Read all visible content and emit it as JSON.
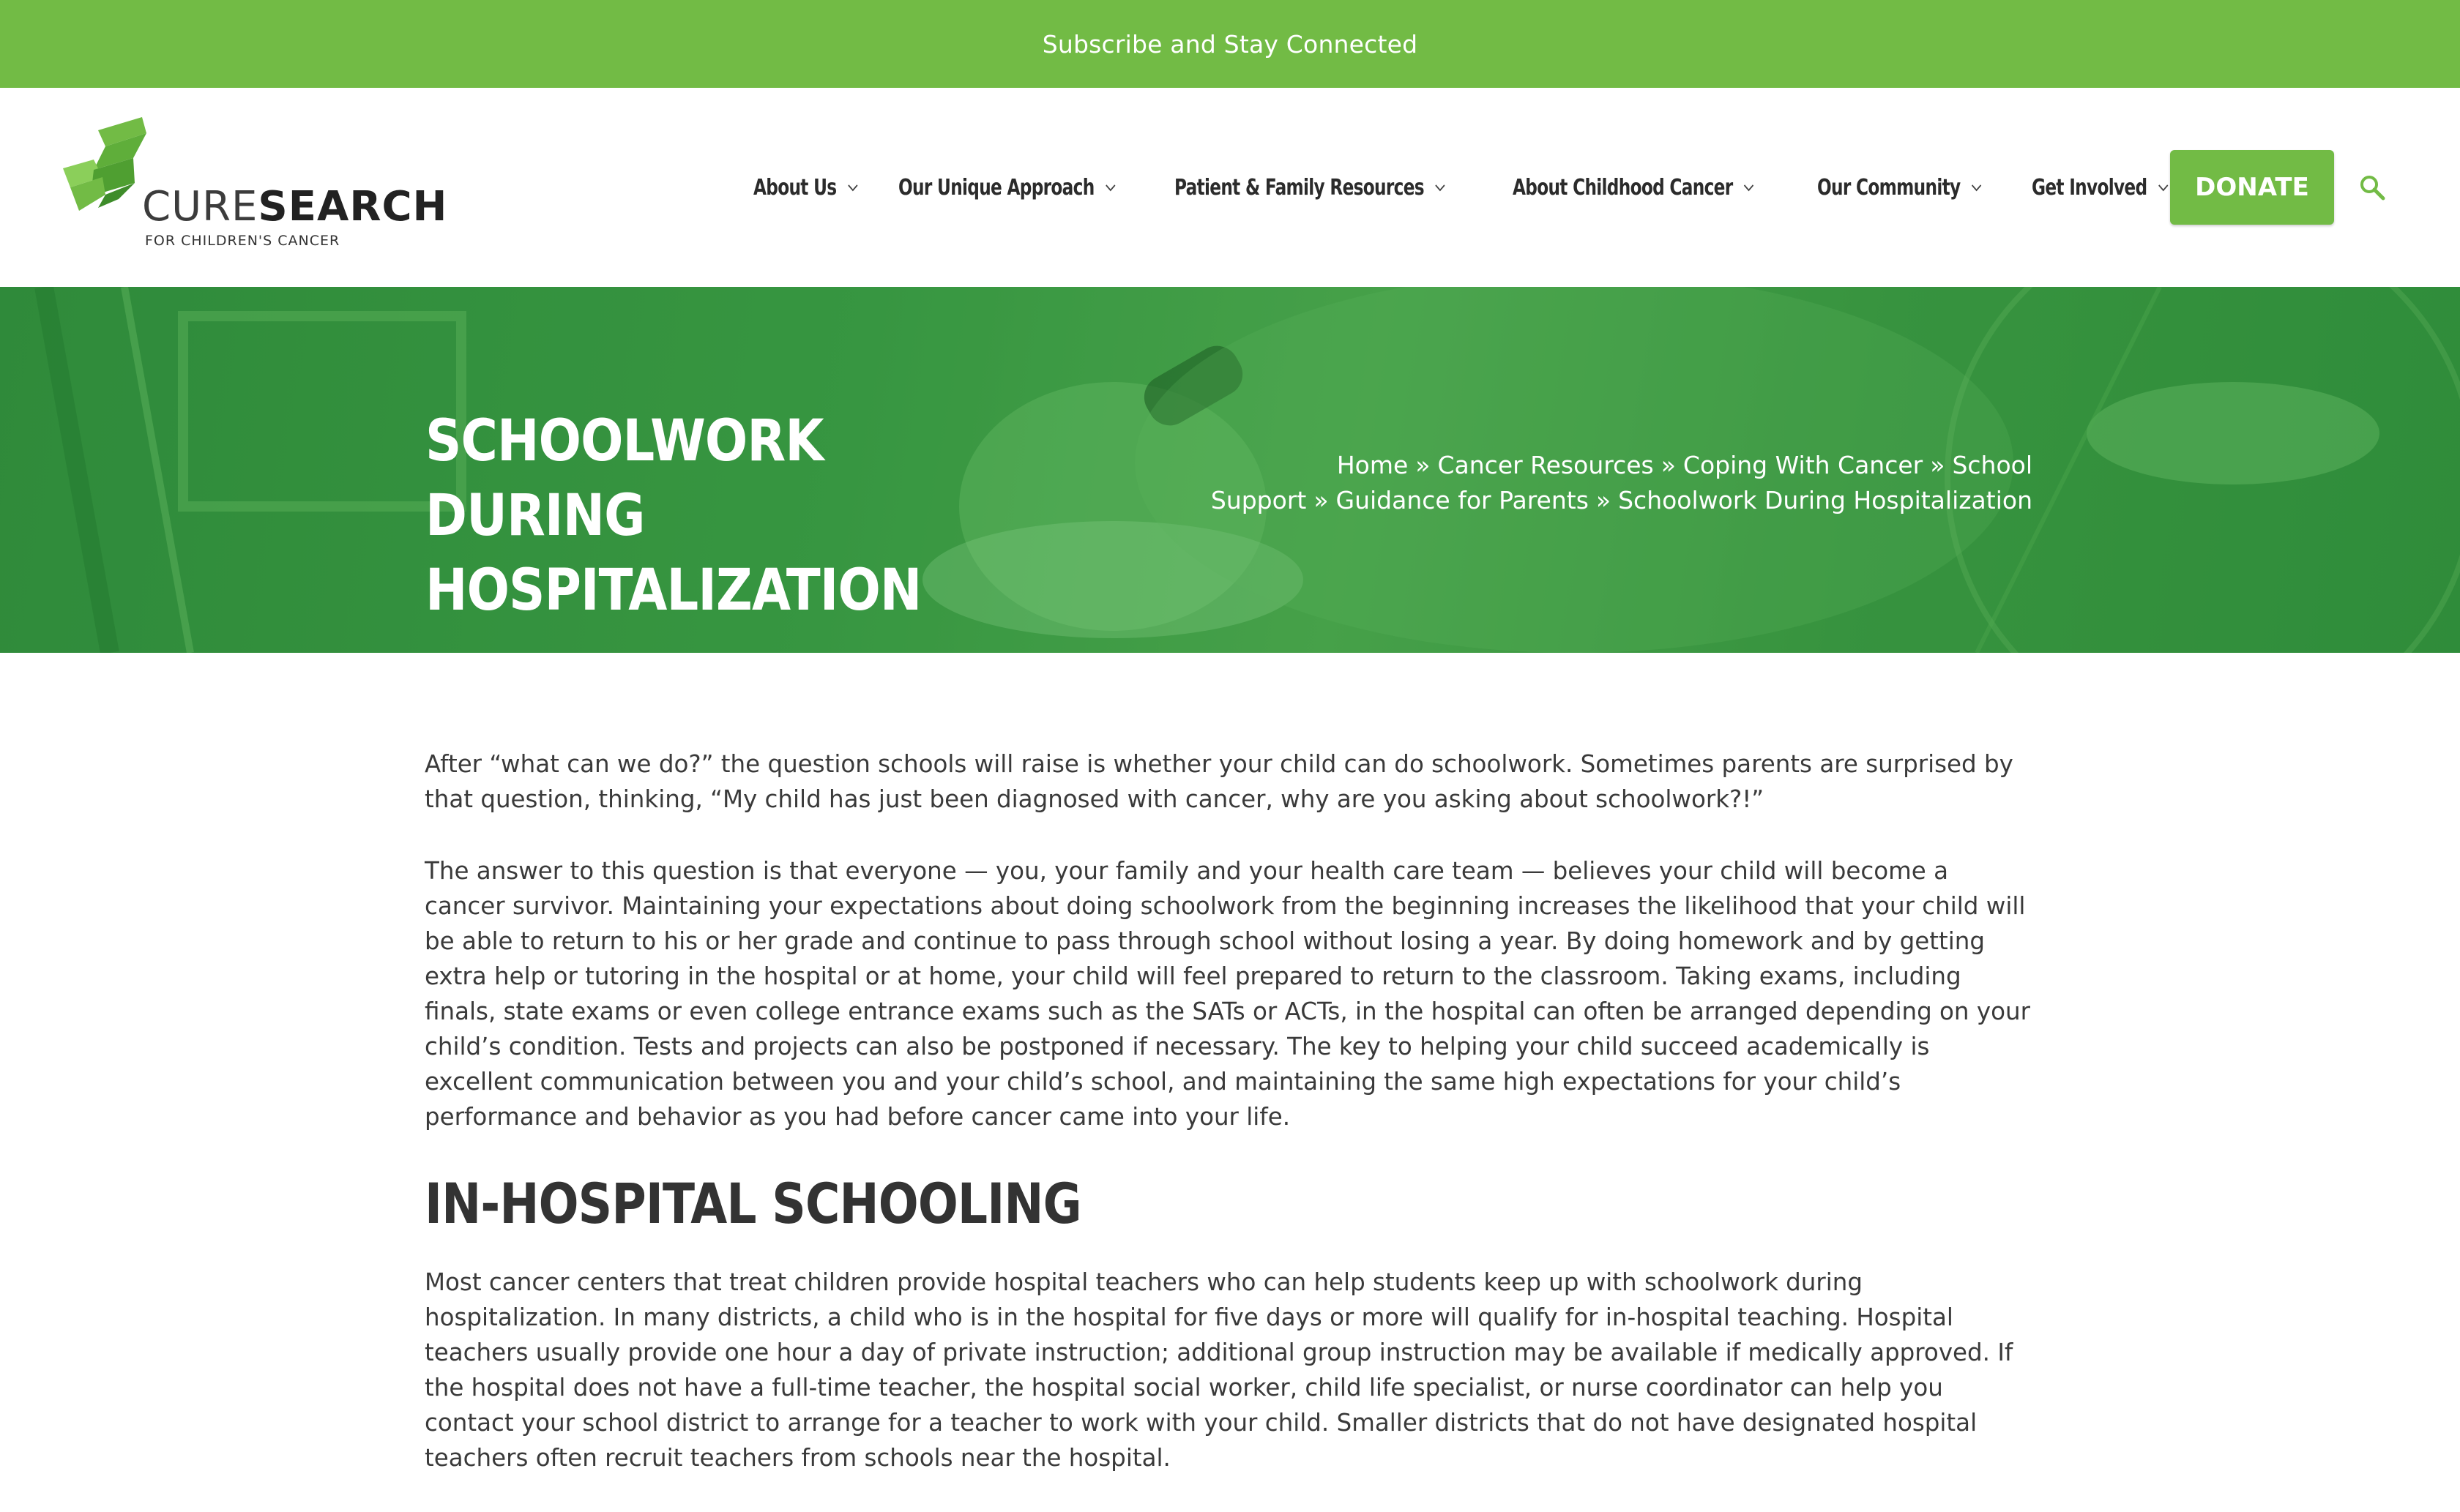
{
  "topbar": {
    "link": "Subscribe and Stay Connected"
  },
  "logo": {
    "cure": "CURE",
    "search": "SEARCH",
    "tagline": "FOR CHILDREN'S CANCER"
  },
  "nav": {
    "items": [
      {
        "label": "About Us"
      },
      {
        "label": "Our Unique Approach"
      },
      {
        "label": "Patient & Family Resources"
      },
      {
        "label": "About Childhood Cancer"
      },
      {
        "label": "Our Community"
      },
      {
        "label": "Get Involved"
      }
    ],
    "donate": "DONATE"
  },
  "hero": {
    "title": "SCHOOLWORK DURING HOSPITALIZATION",
    "breadcrumb": {
      "home": "Home",
      "cancer_resources": "Cancer Resources",
      "coping": "Coping With Cancer",
      "school_support": "School Support",
      "guidance": "Guidance for Parents",
      "current": "Schoolwork During Hospitalization",
      "separator": "»"
    }
  },
  "content": {
    "p1": "After “what can we do?” the question schools will raise is whether your child can do schoolwork. Sometimes parents are surprised by that question, thinking, “My child has just been diagnosed with cancer, why are you asking about schoolwork?!”",
    "p2": "The answer to this question is that everyone — you, your family and your health care team — believes your child will become a cancer survivor. Maintaining your expectations about doing schoolwork from the beginning increases the likelihood that your child will be able to return to his or her grade and continue to pass through school without losing a year. By doing homework and by getting extra help or tutoring in the hospital or at home, your child will feel prepared to return to the classroom. Taking exams, including finals, state exams or even college entrance exams such as the SATs or ACTs, in the hospital can often be arranged depending on your child’s condition. Tests and projects can also be postponed if necessary. The key to helping your child succeed academically is excellent communication between you and your child’s school, and maintaining the same high expectations for your child’s performance and behavior as you had before cancer came into your life.",
    "h2": "IN-HOSPITAL SCHOOLING",
    "p3": "Most cancer centers that treat children provide hospital teachers who can help students keep up with schoolwork during hospitalization. In many districts, a child who is in the hospital for five days or more will qualify for in-hospital teaching. Hospital teachers usually provide one hour a day of private instruction; additional group instruction may be available if medically approved. If the hospital does not have a full-time teacher, the hospital social worker, child life specialist, or nurse coordinator can help you contact your school district to arrange for a teacher to work with your child. Smaller districts that do not have designated hospital teachers often recruit teachers from schools near the hospital."
  },
  "colors": {
    "brand_green": "#72bb45",
    "hero_green": "#3a9a43",
    "text": "#3a3a3a"
  },
  "icons": [
    "logo-mark-icon",
    "chevron-down-icon",
    "search-icon"
  ]
}
